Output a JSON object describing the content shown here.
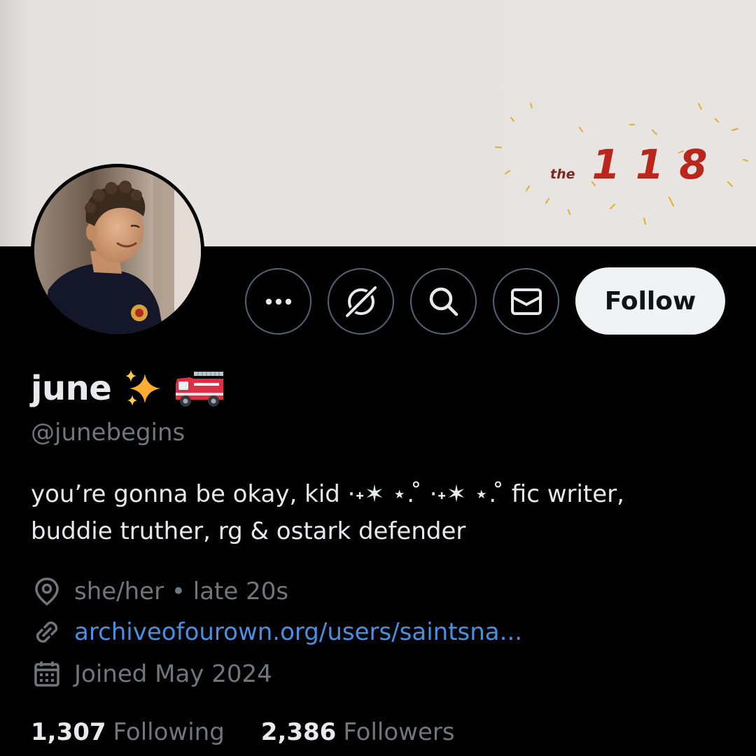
{
  "banner": {
    "the": "the",
    "digits": [
      "1",
      "1",
      "8"
    ]
  },
  "actions": {
    "more": "more-icon",
    "grok": "grok-icon",
    "search": "search-icon",
    "message": "message-icon",
    "follow_label": "Follow"
  },
  "profile": {
    "name": "june",
    "name_emoji": [
      "sparkles-emoji",
      "fire-engine-emoji"
    ],
    "handle": "@junebegins",
    "bio_lines": [
      "you’re gonna be okay, kid ·˖✶ ⋆. ̊ ·˖✶ ⋆. ̊ fic writer,",
      "buddie truther, rg & ostark defender"
    ],
    "location": "she/her • late 20s",
    "website": "archiveofourown.org/users/saintsna...",
    "joined": "Joined May 2024"
  },
  "stats": {
    "following_count": "1,307",
    "following_label": "Following",
    "followers_count": "2,386",
    "followers_label": "Followers"
  },
  "colors": {
    "background": "#000000",
    "follow_bg": "#eff3f4",
    "link": "#4a90e2",
    "secondary_text": "#71767b",
    "banner_red": "#b8261c"
  }
}
